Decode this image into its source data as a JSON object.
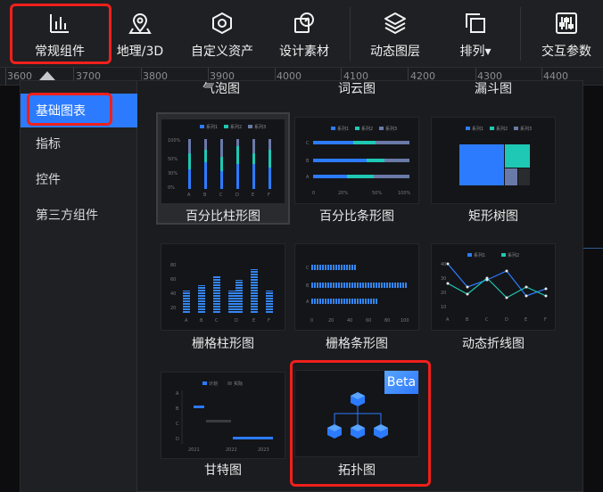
{
  "toolbar": {
    "items": [
      {
        "label": "常规组件",
        "icon": "bar-chart-icon"
      },
      {
        "label": "地理/3D",
        "icon": "map-pin-icon"
      },
      {
        "label": "自定义资产",
        "icon": "hexagon-icon"
      },
      {
        "label": "设计素材",
        "icon": "material-icon"
      },
      {
        "label": "动态图层",
        "icon": "layers-icon"
      },
      {
        "label": "排列▾",
        "icon": "arrange-icon"
      },
      {
        "label": "交互参数",
        "icon": "sliders-icon"
      }
    ]
  },
  "ruler": {
    "ticks": [
      "3600",
      "3700",
      "3800",
      "3900",
      "4000",
      "4100",
      "4200",
      "4300",
      "4400"
    ]
  },
  "sidebar": {
    "items": [
      {
        "label": "基础图表",
        "active": true
      },
      {
        "label": "指标"
      },
      {
        "label": "控件"
      },
      {
        "label": "第三方组件"
      }
    ]
  },
  "gallery": {
    "top_labels": [
      "气泡图",
      "词云图",
      "漏斗图"
    ],
    "cards": [
      {
        "label": "百分比柱形图",
        "selected": true
      },
      {
        "label": "百分比条形图"
      },
      {
        "label": "矩形树图"
      },
      {
        "label": "栅格柱形图"
      },
      {
        "label": "栅格条形图"
      },
      {
        "label": "动态折线图"
      },
      {
        "label": "甘特图"
      },
      {
        "label": "拓扑图",
        "badge": "Beta"
      }
    ],
    "thumb": {
      "legend": [
        "系列1",
        "系列2",
        "系列3"
      ],
      "percent_bar": {
        "yticks": [
          "100%",
          "50%",
          "30%",
          "0%"
        ],
        "xticks": [
          "A",
          "B",
          "C",
          "D",
          "E",
          "F"
        ]
      },
      "percent_hbar": {
        "yticks": [
          "C",
          "B",
          "A"
        ],
        "xticks": [
          "0",
          "20%",
          "50%",
          "100%"
        ]
      },
      "grid_bar": {
        "yticks": [
          "80",
          "60",
          "40",
          "20"
        ],
        "xticks": [
          "A",
          "B",
          "C",
          "D",
          "E",
          "F"
        ]
      },
      "grid_hbar": {
        "yticks": [
          "C",
          "B",
          "A"
        ],
        "xticks": [
          "0",
          "20",
          "40",
          "60",
          "80",
          "100"
        ]
      },
      "line": {
        "yticks": [
          "40",
          "30",
          "20",
          "10"
        ],
        "xticks": [
          "A",
          "B",
          "C",
          "D",
          "E",
          "F"
        ]
      },
      "gantt": {
        "legend": [
          "计划",
          "实际"
        ],
        "yticks": [
          "A",
          "B",
          "C",
          "D"
        ],
        "xticks": [
          "2021",
          "2022",
          "2023"
        ]
      }
    }
  },
  "colors": {
    "accent": "#2c7bff",
    "highlight": "#f0201c",
    "teal": "#1ec8b4",
    "slate": "#6a7aa8"
  }
}
